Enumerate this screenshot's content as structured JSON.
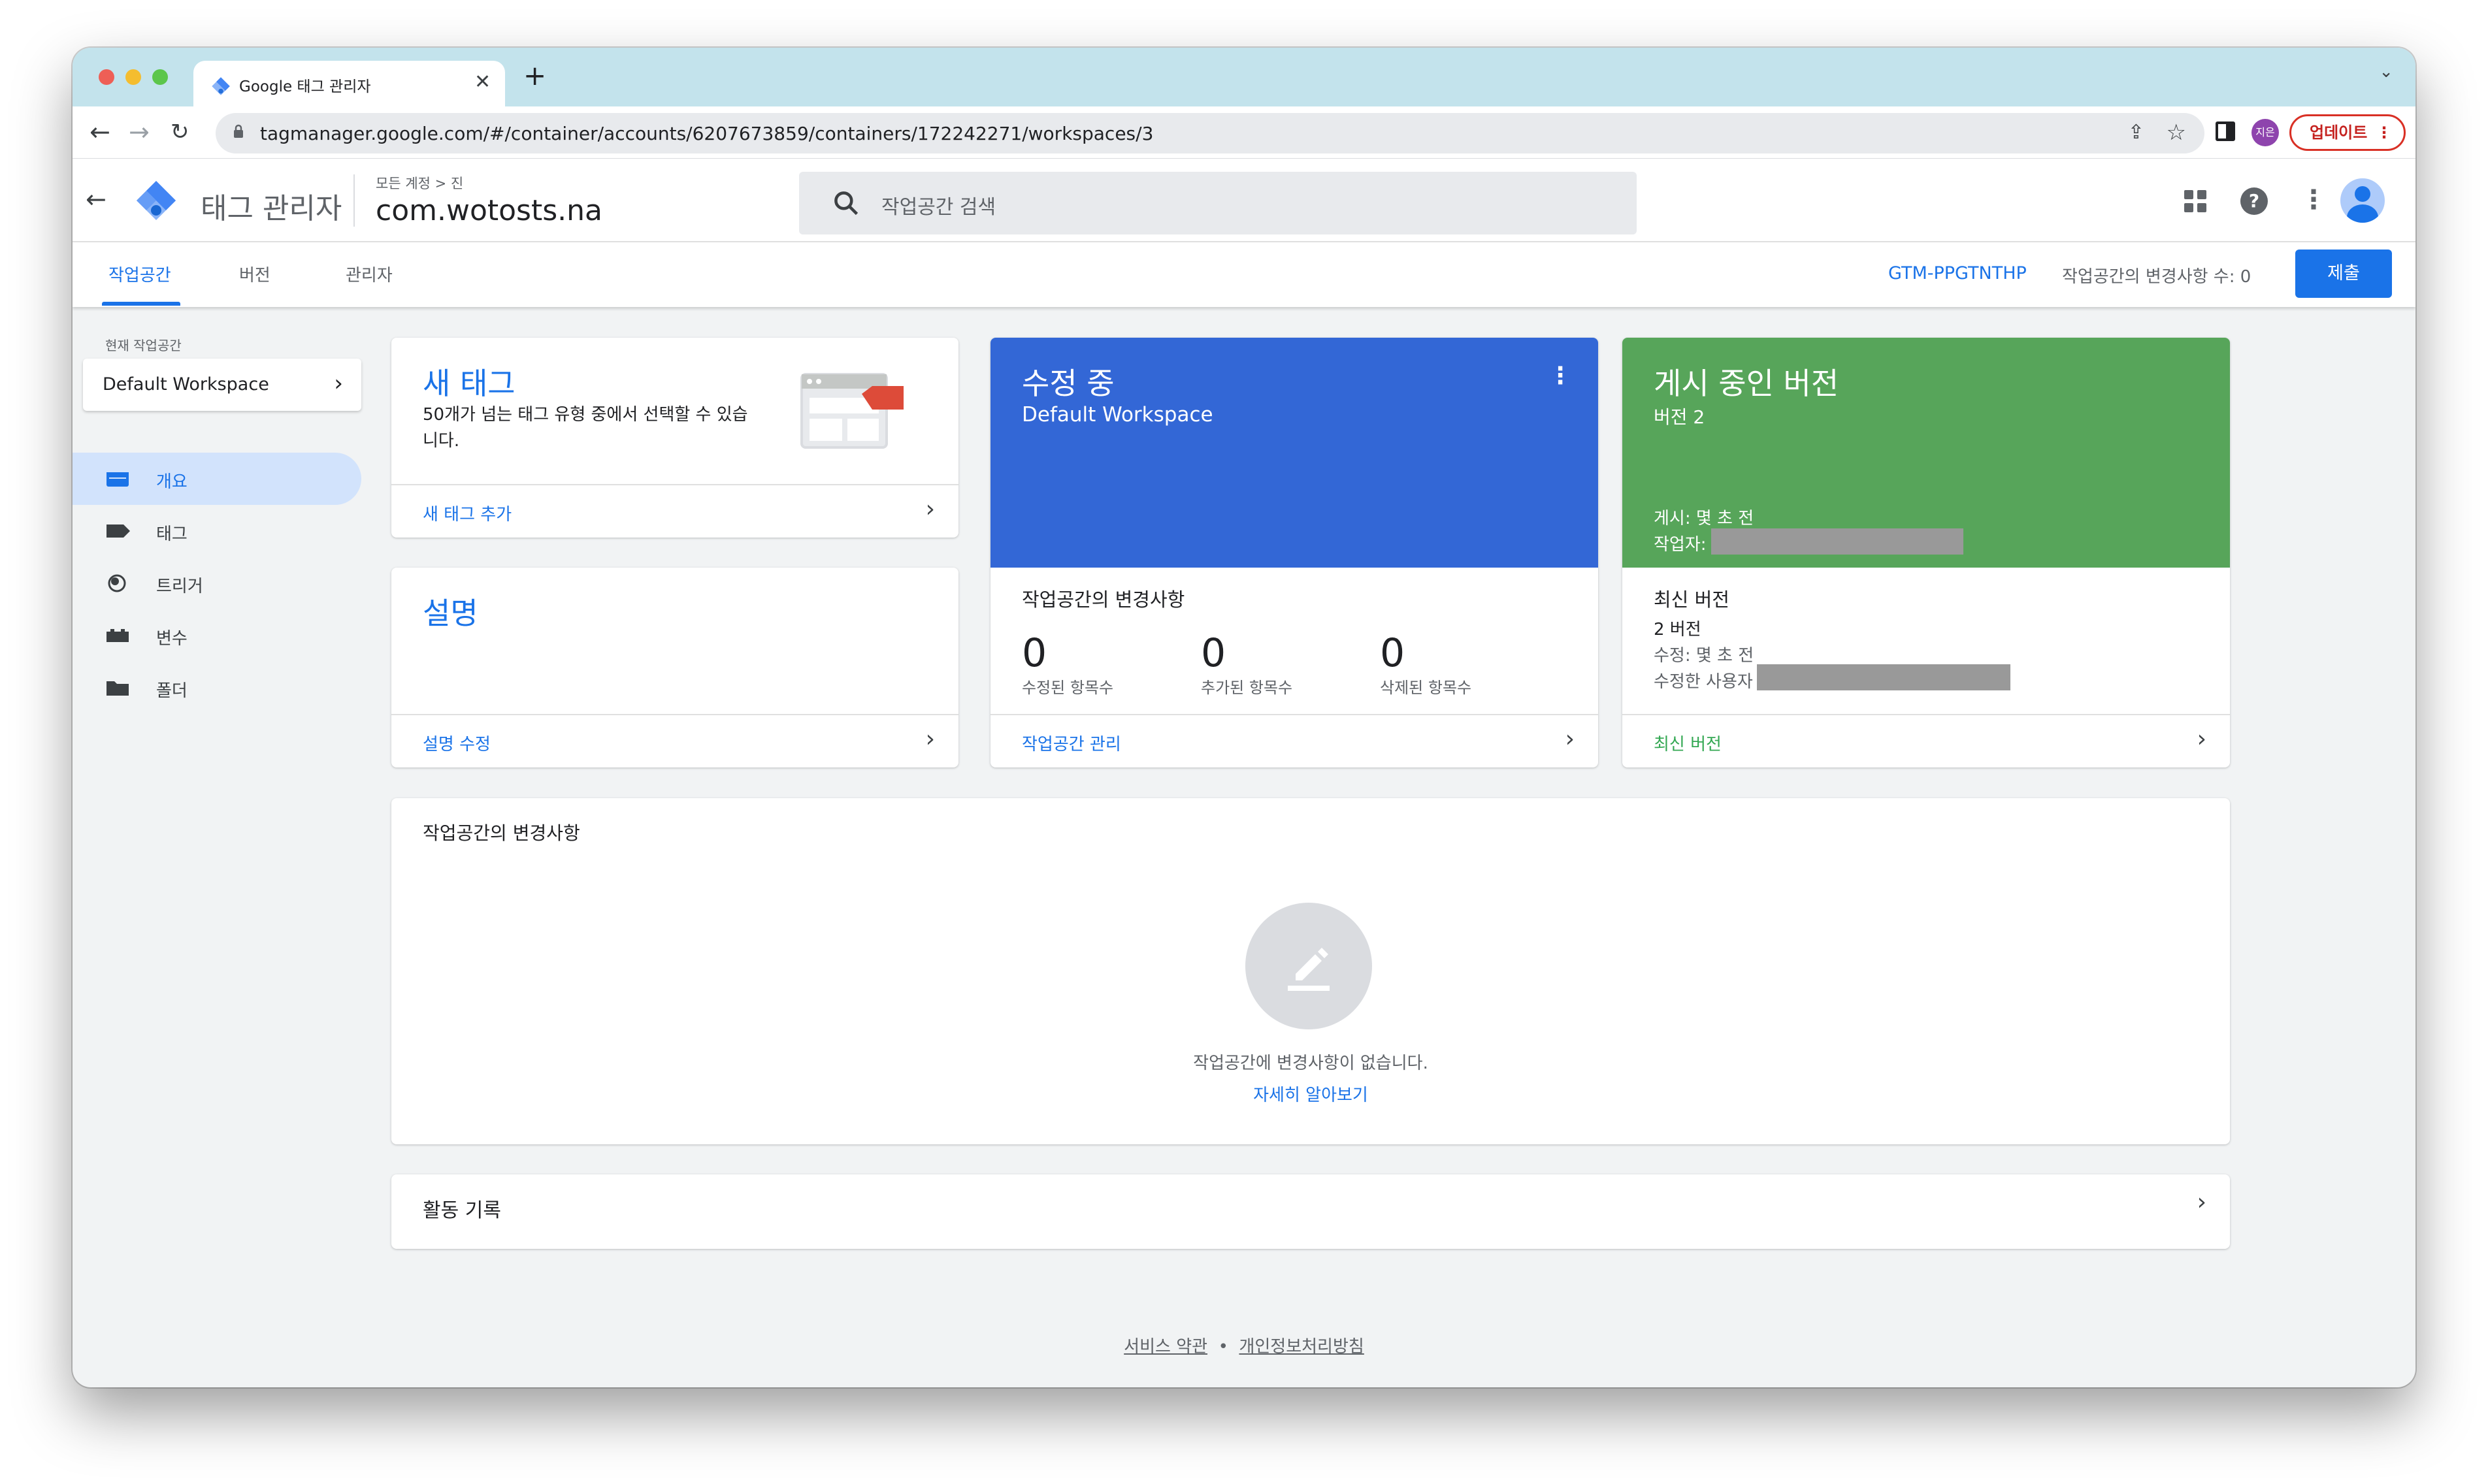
{
  "browser": {
    "tab_title": "Google 태그 관리자",
    "new_tab": "+",
    "url": "tagmanager.google.com/#/container/accounts/6207673859/containers/172242271/workspaces/3",
    "profile_initials": "지은",
    "update_label": "업데이트"
  },
  "header": {
    "app_title": "태그 관리자",
    "breadcrumb": "모든 계정 > 진",
    "container_name": "com.wotosts.na",
    "search_placeholder": "작업공간 검색"
  },
  "nav": {
    "tabs": [
      {
        "label": "작업공간",
        "active": true
      },
      {
        "label": "버전",
        "active": false
      },
      {
        "label": "관리자",
        "active": false
      }
    ],
    "container_id": "GTM-PPGTNTHP",
    "changes_count": "작업공간의 변경사항 수: 0",
    "submit_label": "제출"
  },
  "sidebar": {
    "caption": "현재 작업공간",
    "workspace": "Default Workspace",
    "items": [
      {
        "label": "개요",
        "icon": "overview-icon",
        "active": true
      },
      {
        "label": "태그",
        "icon": "tag-icon",
        "active": false
      },
      {
        "label": "트리거",
        "icon": "trigger-icon",
        "active": false
      },
      {
        "label": "변수",
        "icon": "variable-icon",
        "active": false
      },
      {
        "label": "폴더",
        "icon": "folder-icon",
        "active": false
      }
    ]
  },
  "new_tag_card": {
    "title": "새 태그",
    "description": "50개가 넘는 태그 유형 중에서 선택할 수 있습니다.",
    "link": "새 태그 추가"
  },
  "description_card": {
    "title": "설명",
    "link": "설명 수정"
  },
  "editing_card": {
    "title": "수정 중",
    "workspace": "Default Workspace",
    "changes_title": "작업공간의 변경사항",
    "stats": [
      {
        "value": "0",
        "label": "수정된 항목수"
      },
      {
        "value": "0",
        "label": "추가된 항목수"
      },
      {
        "value": "0",
        "label": "삭제된 항목수"
      }
    ],
    "link": "작업공간 관리",
    "color": "#3367d6"
  },
  "live_card": {
    "title": "게시 중인 버전",
    "version": "버전 2",
    "published": "게시: 몇 초 전",
    "author": "작업자:",
    "latest_title": "최신 버전",
    "latest_version": "2 버전",
    "modified": "수정: 몇 초 전",
    "modified_by": "수정한 사용자",
    "link": "최신 버전",
    "color": "#57a55a"
  },
  "changes_panel": {
    "title": "작업공간의 변경사항",
    "empty_text": "작업공간에 변경사항이 없습니다.",
    "learn_more": "자세히 알아보기"
  },
  "activity": {
    "title": "활동 기록"
  },
  "footer": {
    "terms": "서비스 약관",
    "separator": "•",
    "privacy": "개인정보처리방침"
  }
}
